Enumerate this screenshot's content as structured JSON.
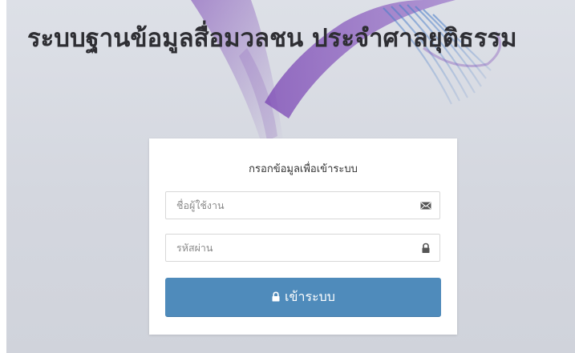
{
  "page": {
    "title": "ระบบฐานข้อมูลสื่อมวลชน ประจำศาลยุติธรรม"
  },
  "login_form": {
    "heading": "กรอกข้อมูลเพื่อเข้าระบบ",
    "username_placeholder": "ชื่อผู้ใช้งาน",
    "username_value": "",
    "username_icon": "envelope-icon",
    "password_placeholder": "รหัสผ่าน",
    "password_value": "",
    "password_icon": "lock-icon",
    "submit_label": "เข้าระบบ",
    "submit_icon": "lock-icon"
  },
  "colors": {
    "page_background": "#d3d5dc",
    "title_text": "#2e2e33",
    "card_background": "#ffffff",
    "button_background": "#4f8bbb",
    "button_text": "#ffffff",
    "watermark_purple": "#7a45b4",
    "watermark_blue": "#4a7ec8"
  }
}
